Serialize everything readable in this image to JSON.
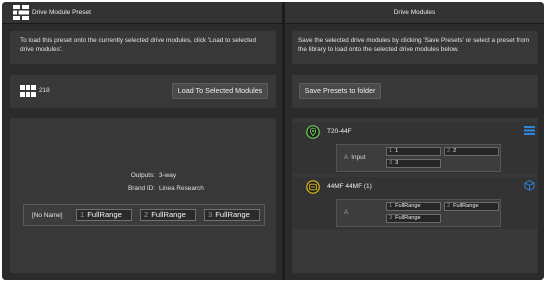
{
  "left": {
    "header_title": "Drive Module Preset",
    "description": "To load this preset onto the currently selected drive modules, click 'Load to selected drive modules'.",
    "preset_number": "218",
    "load_button": "Load To Selected Modules",
    "outputs_label": "Outputs:",
    "outputs_value": "3-way",
    "brand_label": "Brand ID:",
    "brand_value": "Linea Research",
    "drive_name": "[No Name]",
    "slots": [
      {
        "num": "1",
        "value": "FullRange"
      },
      {
        "num": "2",
        "value": "FullRange"
      },
      {
        "num": "3",
        "value": "FullRange"
      }
    ]
  },
  "right": {
    "header_title": "Drive Modules",
    "description": "Save the selected drive modules by clicking 'Save Presets' or select a preset from the library to load onto the selected drive modules below.",
    "save_button": "Save Presets to folder",
    "modules": [
      {
        "name": "T20-44F",
        "channel": "A",
        "input_label": "Input",
        "slots": [
          {
            "num": "1",
            "value": "1"
          },
          {
            "num": "2",
            "value": "2"
          },
          {
            "num": "3",
            "value": "3"
          }
        ]
      },
      {
        "name": "44MF  44MF (1)",
        "channel": "A",
        "slots": [
          {
            "num": "1",
            "value": "FullRange"
          },
          {
            "num": "2",
            "value": "FullRange"
          },
          {
            "num": "3",
            "value": "FullRange"
          }
        ]
      }
    ]
  },
  "colors": {
    "background": "#2b2b2b",
    "panel": "#383838",
    "accent_blue": "#2e86e0",
    "accent_green": "#6fcf5a",
    "accent_yellow": "#e0c020"
  },
  "icons": [
    "app-grid-icon",
    "preset-grid-icon",
    "location-pin-icon",
    "amp-badge-icon",
    "list-icon",
    "cube-icon"
  ]
}
